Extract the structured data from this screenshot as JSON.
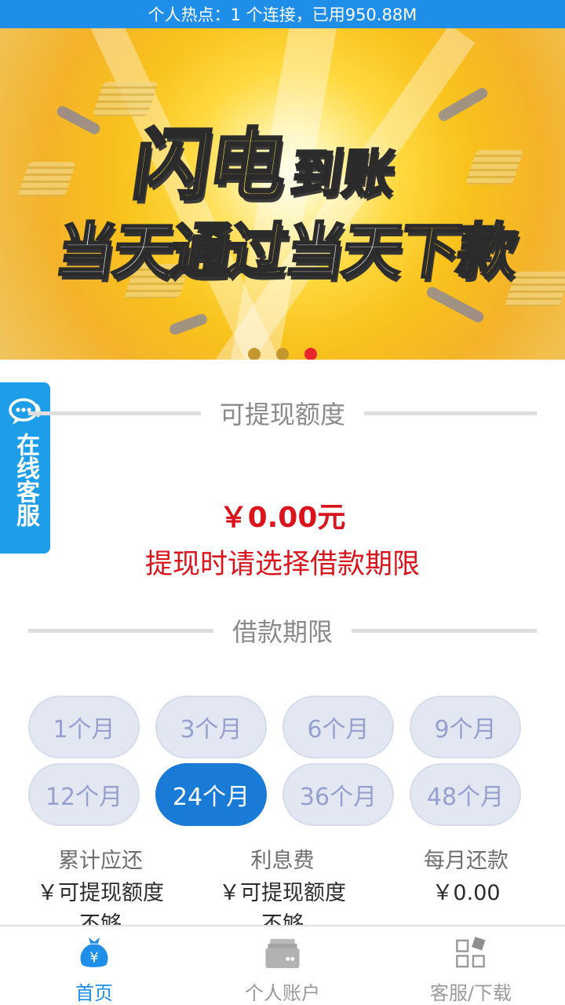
{
  "status_bar": {
    "text": "个人热点：1 个连接，已用950.88M"
  },
  "banner": {
    "headline_big": "闪电",
    "headline_small": "到账",
    "headline2_parts": [
      {
        "text": "当天",
        "color": "#ffffff"
      },
      {
        "text": "通过",
        "color": "#ffe94d"
      },
      {
        "text": "当天",
        "color": "#ffffff"
      },
      {
        "text": "下款",
        "color": "#ffc42a"
      }
    ],
    "carousel": {
      "count": 3,
      "active_index": 2
    }
  },
  "side_service": {
    "label": "在线客服",
    "icon": "chat-bubble-icon"
  },
  "withdraw": {
    "section_title": "可提现额度",
    "amount": "￥0.00元",
    "hint": "提现时请选择借款期限"
  },
  "loan_term": {
    "section_title": "借款期限",
    "options": [
      "1个月",
      "3个月",
      "6个月",
      "9个月",
      "12个月",
      "24个月",
      "36个月",
      "48个月"
    ],
    "selected": "24个月"
  },
  "summary": {
    "total": {
      "label": "累计应还",
      "value": "￥可提现额度",
      "value_line2": "不够"
    },
    "interest": {
      "label": "利息费",
      "value": "￥可提现额度",
      "value_line2": "不够"
    },
    "monthly": {
      "label": "每月还款",
      "value": "￥0.00"
    }
  },
  "tabbar": {
    "items": [
      {
        "label": "首页",
        "icon": "money-bag-icon",
        "active": true
      },
      {
        "label": "个人账户",
        "icon": "wallet-icon",
        "active": false
      },
      {
        "label": "客服/下载",
        "icon": "grid-apps-icon",
        "active": false
      }
    ],
    "accent": "#1e8ee8"
  },
  "colors": {
    "primary": "#1e8ee8",
    "selected": "#1a7bd6",
    "danger": "#d9141c"
  }
}
